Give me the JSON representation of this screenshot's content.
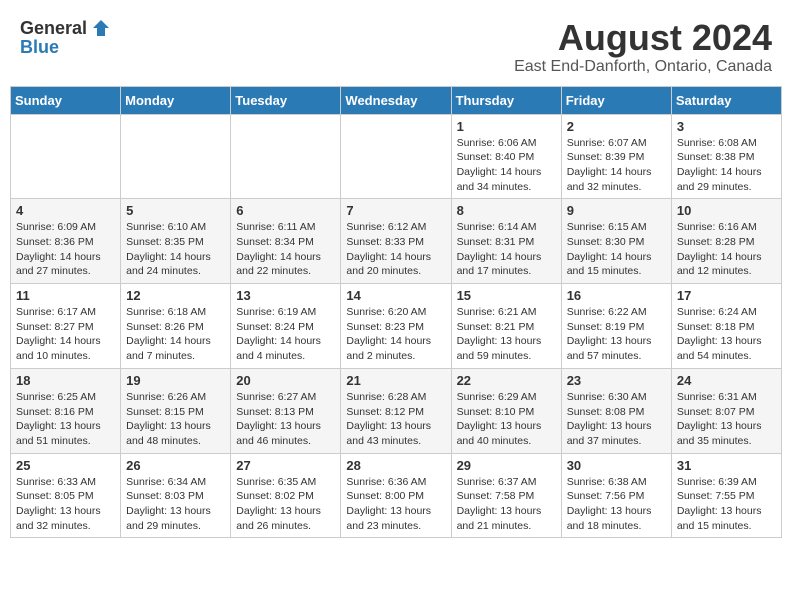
{
  "header": {
    "logo_general": "General",
    "logo_blue": "Blue",
    "main_title": "August 2024",
    "subtitle": "East End-Danforth, Ontario, Canada"
  },
  "calendar": {
    "days_of_week": [
      "Sunday",
      "Monday",
      "Tuesday",
      "Wednesday",
      "Thursday",
      "Friday",
      "Saturday"
    ],
    "weeks": [
      [
        {
          "day": "",
          "info": ""
        },
        {
          "day": "",
          "info": ""
        },
        {
          "day": "",
          "info": ""
        },
        {
          "day": "",
          "info": ""
        },
        {
          "day": "1",
          "info": "Sunrise: 6:06 AM\nSunset: 8:40 PM\nDaylight: 14 hours and 34 minutes."
        },
        {
          "day": "2",
          "info": "Sunrise: 6:07 AM\nSunset: 8:39 PM\nDaylight: 14 hours and 32 minutes."
        },
        {
          "day": "3",
          "info": "Sunrise: 6:08 AM\nSunset: 8:38 PM\nDaylight: 14 hours and 29 minutes."
        }
      ],
      [
        {
          "day": "4",
          "info": "Sunrise: 6:09 AM\nSunset: 8:36 PM\nDaylight: 14 hours and 27 minutes."
        },
        {
          "day": "5",
          "info": "Sunrise: 6:10 AM\nSunset: 8:35 PM\nDaylight: 14 hours and 24 minutes."
        },
        {
          "day": "6",
          "info": "Sunrise: 6:11 AM\nSunset: 8:34 PM\nDaylight: 14 hours and 22 minutes."
        },
        {
          "day": "7",
          "info": "Sunrise: 6:12 AM\nSunset: 8:33 PM\nDaylight: 14 hours and 20 minutes."
        },
        {
          "day": "8",
          "info": "Sunrise: 6:14 AM\nSunset: 8:31 PM\nDaylight: 14 hours and 17 minutes."
        },
        {
          "day": "9",
          "info": "Sunrise: 6:15 AM\nSunset: 8:30 PM\nDaylight: 14 hours and 15 minutes."
        },
        {
          "day": "10",
          "info": "Sunrise: 6:16 AM\nSunset: 8:28 PM\nDaylight: 14 hours and 12 minutes."
        }
      ],
      [
        {
          "day": "11",
          "info": "Sunrise: 6:17 AM\nSunset: 8:27 PM\nDaylight: 14 hours and 10 minutes."
        },
        {
          "day": "12",
          "info": "Sunrise: 6:18 AM\nSunset: 8:26 PM\nDaylight: 14 hours and 7 minutes."
        },
        {
          "day": "13",
          "info": "Sunrise: 6:19 AM\nSunset: 8:24 PM\nDaylight: 14 hours and 4 minutes."
        },
        {
          "day": "14",
          "info": "Sunrise: 6:20 AM\nSunset: 8:23 PM\nDaylight: 14 hours and 2 minutes."
        },
        {
          "day": "15",
          "info": "Sunrise: 6:21 AM\nSunset: 8:21 PM\nDaylight: 13 hours and 59 minutes."
        },
        {
          "day": "16",
          "info": "Sunrise: 6:22 AM\nSunset: 8:19 PM\nDaylight: 13 hours and 57 minutes."
        },
        {
          "day": "17",
          "info": "Sunrise: 6:24 AM\nSunset: 8:18 PM\nDaylight: 13 hours and 54 minutes."
        }
      ],
      [
        {
          "day": "18",
          "info": "Sunrise: 6:25 AM\nSunset: 8:16 PM\nDaylight: 13 hours and 51 minutes."
        },
        {
          "day": "19",
          "info": "Sunrise: 6:26 AM\nSunset: 8:15 PM\nDaylight: 13 hours and 48 minutes."
        },
        {
          "day": "20",
          "info": "Sunrise: 6:27 AM\nSunset: 8:13 PM\nDaylight: 13 hours and 46 minutes."
        },
        {
          "day": "21",
          "info": "Sunrise: 6:28 AM\nSunset: 8:12 PM\nDaylight: 13 hours and 43 minutes."
        },
        {
          "day": "22",
          "info": "Sunrise: 6:29 AM\nSunset: 8:10 PM\nDaylight: 13 hours and 40 minutes."
        },
        {
          "day": "23",
          "info": "Sunrise: 6:30 AM\nSunset: 8:08 PM\nDaylight: 13 hours and 37 minutes."
        },
        {
          "day": "24",
          "info": "Sunrise: 6:31 AM\nSunset: 8:07 PM\nDaylight: 13 hours and 35 minutes."
        }
      ],
      [
        {
          "day": "25",
          "info": "Sunrise: 6:33 AM\nSunset: 8:05 PM\nDaylight: 13 hours and 32 minutes."
        },
        {
          "day": "26",
          "info": "Sunrise: 6:34 AM\nSunset: 8:03 PM\nDaylight: 13 hours and 29 minutes."
        },
        {
          "day": "27",
          "info": "Sunrise: 6:35 AM\nSunset: 8:02 PM\nDaylight: 13 hours and 26 minutes."
        },
        {
          "day": "28",
          "info": "Sunrise: 6:36 AM\nSunset: 8:00 PM\nDaylight: 13 hours and 23 minutes."
        },
        {
          "day": "29",
          "info": "Sunrise: 6:37 AM\nSunset: 7:58 PM\nDaylight: 13 hours and 21 minutes."
        },
        {
          "day": "30",
          "info": "Sunrise: 6:38 AM\nSunset: 7:56 PM\nDaylight: 13 hours and 18 minutes."
        },
        {
          "day": "31",
          "info": "Sunrise: 6:39 AM\nSunset: 7:55 PM\nDaylight: 13 hours and 15 minutes."
        }
      ]
    ]
  }
}
